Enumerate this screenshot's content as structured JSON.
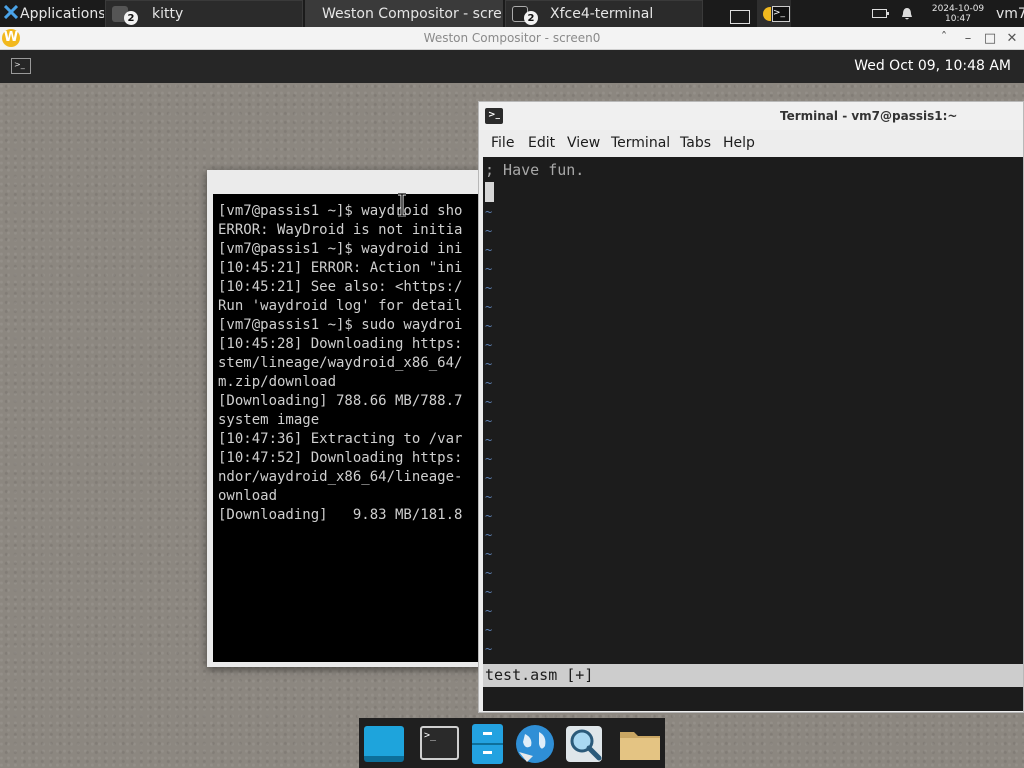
{
  "xfce_panel": {
    "applications_label": "Applications",
    "tasks": [
      {
        "label": "kitty",
        "badge": "2"
      },
      {
        "label": "Weston Compositor - scre..."
      },
      {
        "label": "Xfce4-terminal",
        "badge": "2"
      }
    ],
    "clock_date": "2024-10-09",
    "clock_time": "10:47",
    "user": "vm7"
  },
  "weston": {
    "title": "Weston Compositor - screen0",
    "logo_letter": "W",
    "clock": "Wed Oct 09, 10:48 AM"
  },
  "kitty": {
    "lines": [
      "[vm7@passis1 ~]$ waydroid sho",
      "ERROR: WayDroid is not initia",
      "[vm7@passis1 ~]$ waydroid ini",
      "[10:45:21] ERROR: Action \"ini",
      "[10:45:21] See also: <https:/",
      "Run 'waydroid log' for detail",
      "[vm7@passis1 ~]$ sudo waydroi",
      "[10:45:28] Downloading https:",
      "stem/lineage/waydroid_x86_64/",
      "m.zip/download",
      "[Downloading] 788.66 MB/788.7",
      "system image",
      "[10:47:36] Extracting to /var",
      "[10:47:52] Downloading https:",
      "ndor/waydroid_x86_64/lineage-",
      "ownload",
      "[Downloading]   9.83 MB/181.8"
    ]
  },
  "terminal": {
    "title": "Terminal - vm7@passis1:~",
    "menu": [
      "File",
      "Edit",
      "View",
      "Terminal",
      "Tabs",
      "Help"
    ],
    "first_line": "; Have fun.",
    "tilde": "~",
    "status_line": "test.asm [+]"
  },
  "dock": {
    "items": [
      "desktop-icon",
      "terminal-icon",
      "file-manager-icon",
      "web-browser-icon",
      "search-icon",
      "folder-icon"
    ]
  },
  "colors": {
    "panel_bg": "#1b1b1b",
    "weston_logo": "#f2b91e",
    "terminal_bg": "#1c1c1c",
    "vim_tilde": "#5d7fb0",
    "desktop_bg": "#8c8780"
  }
}
